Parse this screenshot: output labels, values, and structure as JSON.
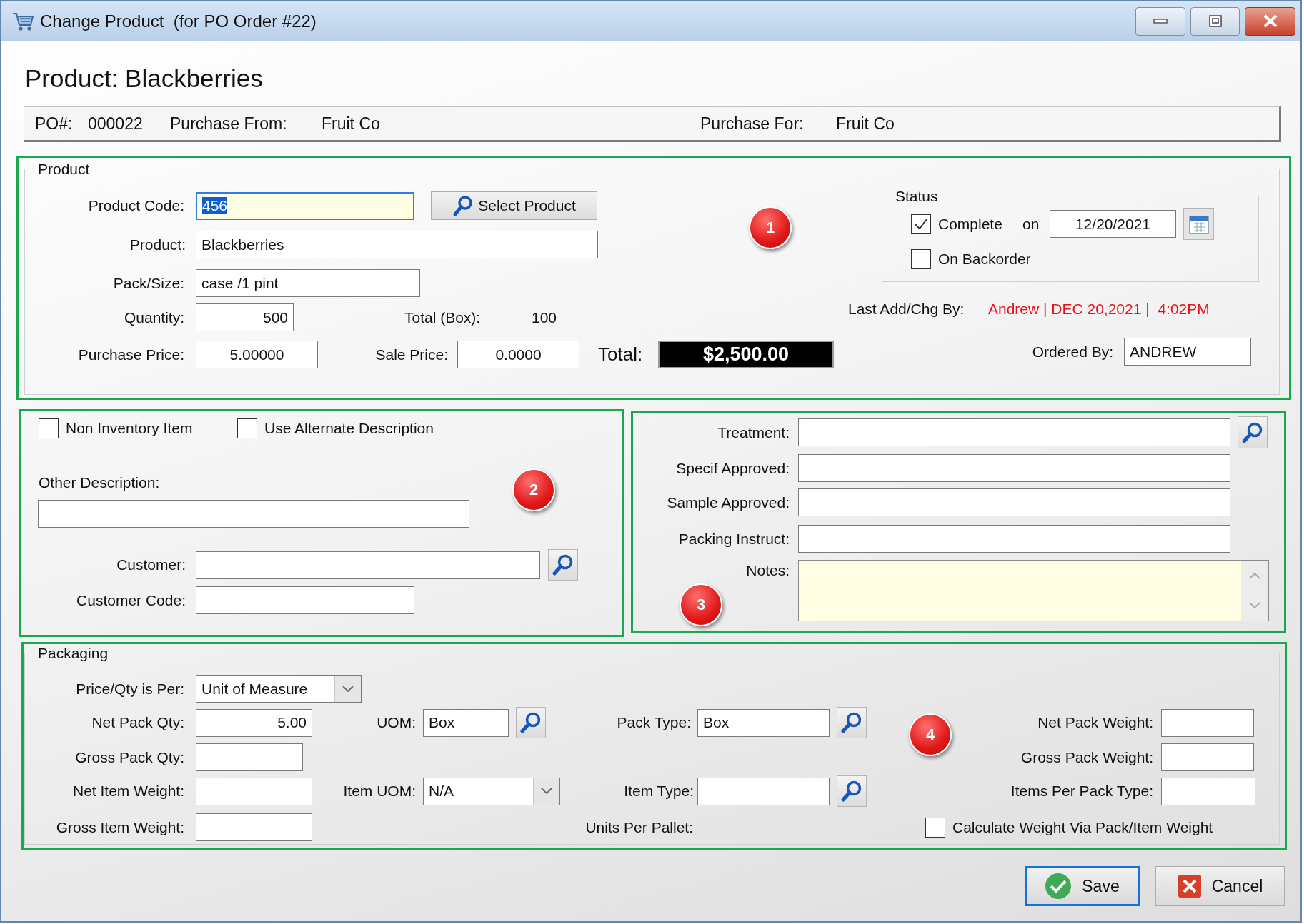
{
  "window": {
    "title": "Change Product  (for PO Order #22)"
  },
  "heading": "Product: Blackberries",
  "info_bar": [
    {
      "label": "PO#:",
      "value": "000022"
    },
    {
      "label": "Purchase From:",
      "value": "Fruit Co"
    },
    {
      "label": "Purchase For:",
      "value": "Fruit Co"
    }
  ],
  "product": {
    "legend": "Product",
    "callout": "1",
    "product_code": {
      "label": "Product Code:",
      "value": "456",
      "focused": true
    },
    "select_button": "Select Product",
    "product_name": {
      "label": "Product:",
      "value": "Blackberries"
    },
    "pack_size": {
      "label": "Pack/Size:",
      "value": "case /1 pint"
    },
    "quantity": {
      "label": "Quantity:",
      "value": "500"
    },
    "total_box": {
      "label": "Total (Box):",
      "value": "100"
    },
    "purchase_price": {
      "label": "Purchase Price:",
      "value": "5.00000"
    },
    "sale_price": {
      "label": "Sale Price:",
      "value": "0.0000"
    },
    "total": {
      "label": "Total:",
      "value": "$2,500.00"
    },
    "status": {
      "legend": "Status",
      "complete": {
        "label": "Complete",
        "checked": true
      },
      "on_label": "on",
      "date": "12/20/2021",
      "backorder": {
        "label": "On Backorder",
        "checked": false
      }
    },
    "last_change": {
      "label": "Last Add/Chg By:",
      "value": "Andrew | DEC 20,2021 |  4:02PM"
    },
    "ordered_by": {
      "label": "Ordered By:",
      "value": "ANDREW"
    }
  },
  "description": {
    "callout": "2",
    "non_inventory": {
      "label": "Non Inventory Item",
      "checked": false
    },
    "alternate_description": {
      "label": "Use Alternate Description",
      "checked": false
    },
    "other_description": {
      "label": "Other Description:"
    },
    "customer": {
      "label": "Customer:"
    },
    "customer_code": {
      "label": "Customer Code:"
    }
  },
  "treatment": {
    "callout": "3",
    "treatment": {
      "label": "Treatment:"
    },
    "specif_approved": {
      "label": "Specif Approved:"
    },
    "sample_approved": {
      "label": "Sample Approved:"
    },
    "packing_instruct": {
      "label": "Packing Instruct:"
    },
    "notes": {
      "label": "Notes:"
    }
  },
  "packaging": {
    "legend": "Packaging",
    "callout": "4",
    "price_qty_per": {
      "label": "Price/Qty is Per:",
      "value": "Unit of Measure"
    },
    "net_pack_qty": {
      "label": "Net Pack Qty:",
      "value": "5.00"
    },
    "uom": {
      "label": "UOM:",
      "value": "Box"
    },
    "pack_type": {
      "label": "Pack Type:",
      "value": "Box"
    },
    "net_pack_weight": {
      "label": "Net Pack Weight:"
    },
    "gross_pack_qty": {
      "label": "Gross Pack Qty:"
    },
    "gross_pack_weight": {
      "label": "Gross Pack Weight:"
    },
    "net_item_weight": {
      "label": "Net Item Weight:"
    },
    "item_uom": {
      "label": "Item UOM:",
      "value": "N/A"
    },
    "item_type": {
      "label": "Item Type:"
    },
    "items_per_pack_type": {
      "label": "Items Per Pack Type:"
    },
    "gross_item_weight": {
      "label": "Gross Item Weight:"
    },
    "units_per_pallet": {
      "label": "Units Per Pallet:"
    },
    "calculate_weight": {
      "label": "Calculate Weight Via Pack/Item Weight",
      "checked": false
    }
  },
  "buttons": [
    {
      "kind": "save",
      "label": "Save",
      "default": true
    },
    {
      "kind": "cancel",
      "label": "Cancel",
      "default": false
    }
  ]
}
